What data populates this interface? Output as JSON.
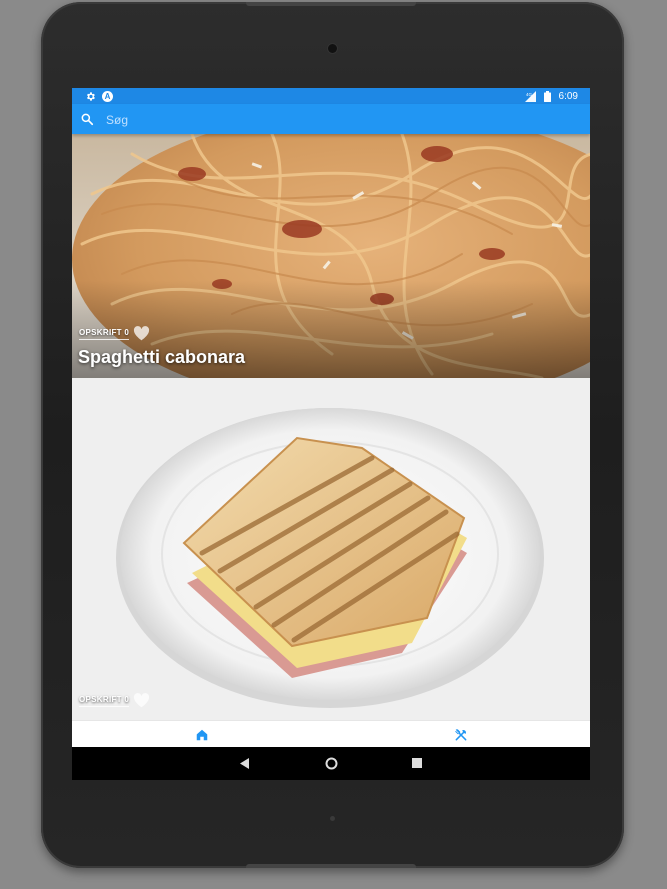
{
  "status_bar": {
    "left_icons": [
      "settings-icon",
      "app-a-icon"
    ],
    "app_badge_letter": "A",
    "right_icons": [
      "signal-icon",
      "battery-icon"
    ],
    "time": "6:09"
  },
  "search": {
    "placeholder": "Søg",
    "value": ""
  },
  "recipes": [
    {
      "category": "OPSKRIFT 0",
      "title": "Spaghetti cabonara",
      "favorite": false,
      "image": "spaghetti-carbonara-photo"
    },
    {
      "category": "OPSKRIFT 0",
      "title": "",
      "favorite": false,
      "image": "toasted-sandwich-photo"
    }
  ],
  "bottom_nav": {
    "items": [
      {
        "icon": "home-icon",
        "active": true
      },
      {
        "icon": "fork-knife-icon",
        "active": false
      }
    ]
  },
  "system_nav": [
    "back-icon",
    "home-circle-icon",
    "recents-icon"
  ],
  "colors": {
    "accent": "#2196f3",
    "statusbar": "#1e88e5",
    "nav_icon": "#2196f3"
  }
}
